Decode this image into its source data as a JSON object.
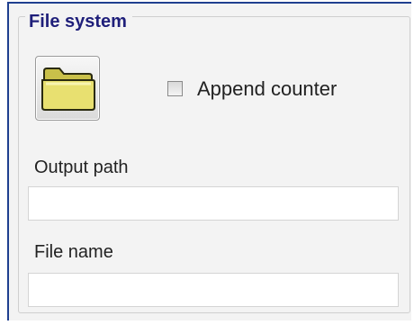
{
  "panel": {
    "title": "File system"
  },
  "folder_button": {
    "icon": "folder-icon",
    "color": "#e8e070"
  },
  "append_counter": {
    "label": "Append counter",
    "checked": false
  },
  "output_path": {
    "label": "Output path",
    "value": "",
    "placeholder": ""
  },
  "file_name": {
    "label": "File name",
    "value": "",
    "placeholder": ""
  },
  "colors": {
    "title": "#1f1f7a",
    "frame_border": "#1f3f8f",
    "panel_background": "#f3f3f3"
  }
}
